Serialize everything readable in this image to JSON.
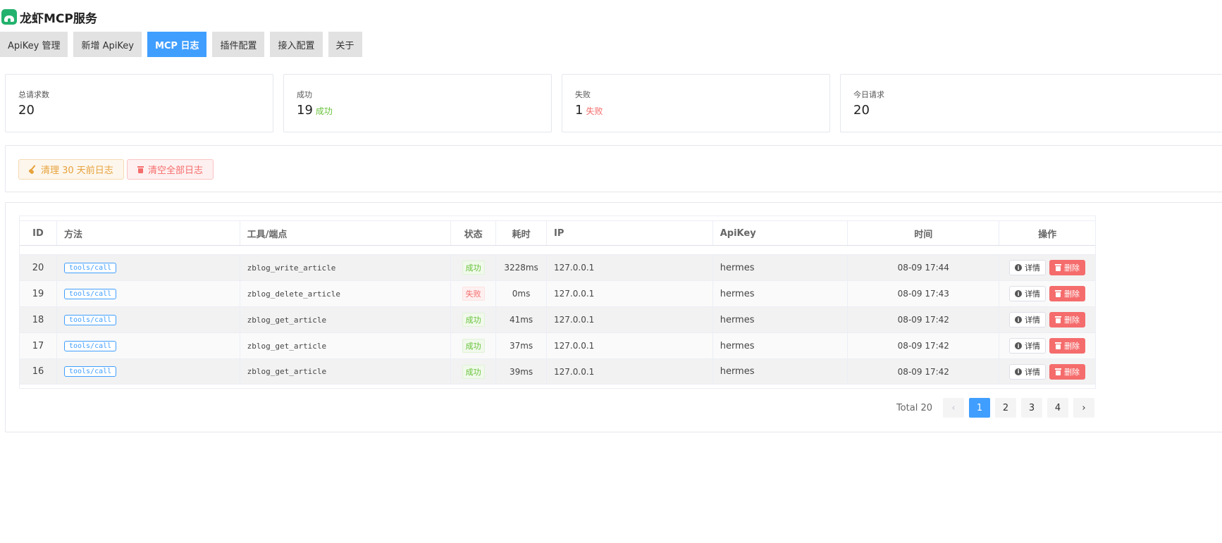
{
  "app": {
    "title": "龙虾MCP服务",
    "logo_icon": "lobster-logo-icon"
  },
  "tabs": [
    {
      "label": "ApiKey 管理",
      "active": false
    },
    {
      "label": "新增 ApiKey",
      "active": false
    },
    {
      "label": "MCP 日志",
      "active": true
    },
    {
      "label": "插件配置",
      "active": false
    },
    {
      "label": "接入配置",
      "active": false
    },
    {
      "label": "关于",
      "active": false
    }
  ],
  "stats": {
    "total": {
      "label": "总请求数",
      "value": "20"
    },
    "success": {
      "label": "成功",
      "value": "19",
      "sub": "成功"
    },
    "failed": {
      "label": "失败",
      "value": "1",
      "sub": "失败"
    },
    "today": {
      "label": "今日请求",
      "value": "20"
    }
  },
  "actions": {
    "clean_30": {
      "label": "清理 30 天前日志",
      "icon": "broom-icon"
    },
    "clear_all": {
      "label": "清空全部日志",
      "icon": "trash-icon"
    }
  },
  "table": {
    "headers": {
      "id": "ID",
      "method": "方法",
      "tool": "工具/端点",
      "status": "状态",
      "duration": "耗时",
      "ip": "IP",
      "apikey": "ApiKey",
      "time": "时间",
      "ops": "操作"
    },
    "detail_label": "详情",
    "delete_label": "删除",
    "rows": [
      {
        "id": "20",
        "method": "tools/call",
        "tool": "zblog_write_article",
        "status": "成功",
        "ok": true,
        "duration": "3228ms",
        "ip": "127.0.0.1",
        "apikey": "hermes",
        "time": "08-09 17:44"
      },
      {
        "id": "19",
        "method": "tools/call",
        "tool": "zblog_delete_article",
        "status": "失败",
        "ok": false,
        "duration": "0ms",
        "ip": "127.0.0.1",
        "apikey": "hermes",
        "time": "08-09 17:43"
      },
      {
        "id": "18",
        "method": "tools/call",
        "tool": "zblog_get_article",
        "status": "成功",
        "ok": true,
        "duration": "41ms",
        "ip": "127.0.0.1",
        "apikey": "hermes",
        "time": "08-09 17:42"
      },
      {
        "id": "17",
        "method": "tools/call",
        "tool": "zblog_get_article",
        "status": "成功",
        "ok": true,
        "duration": "37ms",
        "ip": "127.0.0.1",
        "apikey": "hermes",
        "time": "08-09 17:42"
      },
      {
        "id": "16",
        "method": "tools/call",
        "tool": "zblog_get_article",
        "status": "成功",
        "ok": true,
        "duration": "39ms",
        "ip": "127.0.0.1",
        "apikey": "hermes",
        "time": "08-09 17:42"
      }
    ]
  },
  "pagination": {
    "total_text": "Total 20",
    "prev": "‹",
    "next": "›",
    "pages": [
      "1",
      "2",
      "3",
      "4"
    ],
    "current": "1"
  },
  "colors": {
    "primary": "#409eff",
    "success": "#67c23a",
    "danger": "#f56c6c",
    "warning": "#e6a23c"
  }
}
